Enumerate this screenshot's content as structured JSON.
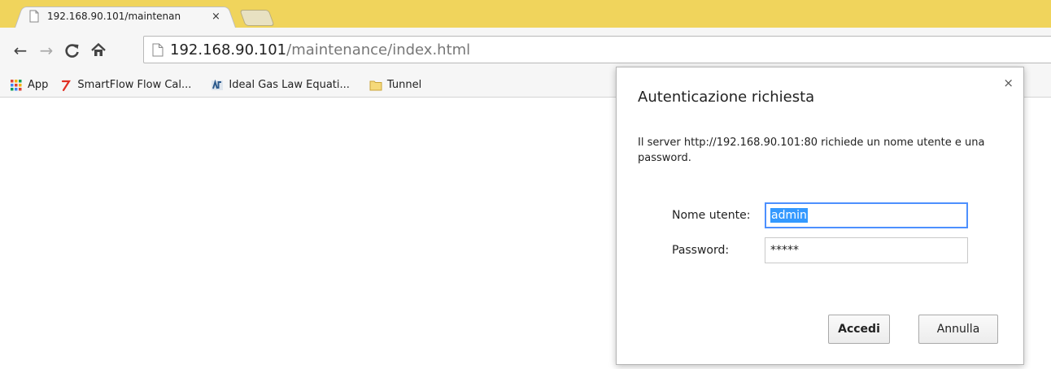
{
  "tab": {
    "title": "192.168.90.101/maintenan",
    "close_glyph": "×",
    "favicon": "page-icon"
  },
  "toolbar": {
    "back_glyph": "←",
    "forward_glyph": "→",
    "reload_glyph": "C",
    "home_glyph": "⌂",
    "url_host": "192.168.90.101",
    "url_path": "/maintenance/index.html"
  },
  "bookmarks": [
    {
      "label": "App",
      "icon": "apps-grid-icon"
    },
    {
      "label": "SmartFlow Flow Cal...",
      "icon": "smartflow-icon"
    },
    {
      "label": "Ideal Gas Law Equati...",
      "icon": "ideal-gas-icon"
    },
    {
      "label": "Tunnel",
      "icon": "folder-icon"
    }
  ],
  "dialog": {
    "title": "Autenticazione richiesta",
    "message": "Il server http://192.168.90.101:80 richiede un nome utente e una password.",
    "close_glyph": "×",
    "username_label": "Nome utente:",
    "username_value": "admin",
    "password_label": "Password:",
    "password_value": "*****",
    "ok_label": "Accedi",
    "cancel_label": "Annulla"
  },
  "colors": {
    "titlebar": "#f0d45c",
    "toolbar": "#f6f6f6",
    "selection": "#3399ff",
    "focus": "#4d90fe"
  }
}
